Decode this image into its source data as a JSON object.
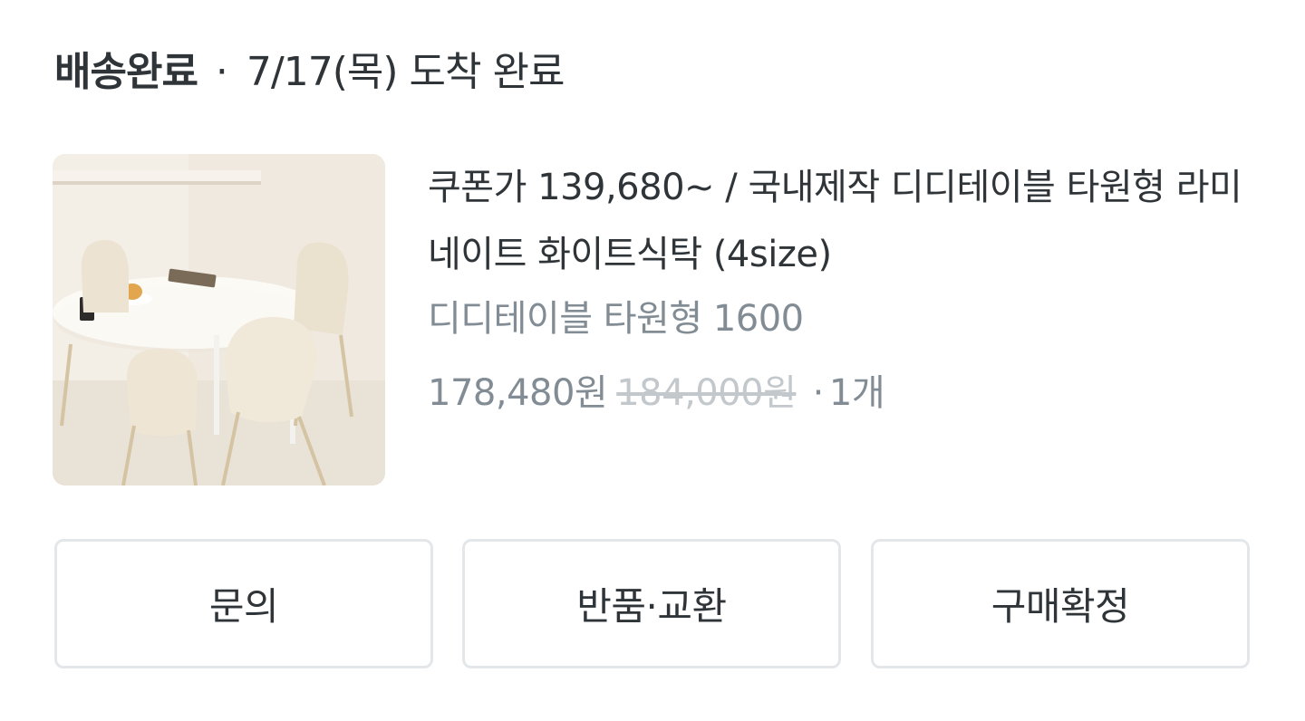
{
  "order": {
    "status": "배송완료",
    "separator": "·",
    "arrival": "7/17(목) 도착 완료"
  },
  "product": {
    "image_alt": "white oval dining table with cream chairs",
    "title": "쿠폰가 139,680~ / 국내제작 디디테이블 타원형 라미네이트 화이트식탁 (4size)",
    "option": "디디테이블 타원형 1600",
    "price_sale": "178,480원",
    "price_original": "184,000원",
    "qty_separator": "·",
    "quantity": "1개"
  },
  "actions": {
    "inquiry": "문의",
    "return_exchange": "반품·교환",
    "confirm_purchase": "구매확정"
  },
  "colors": {
    "text_primary": "#2f3438",
    "text_secondary": "#828c94",
    "text_strike": "#c2c8cc",
    "button_border": "#e4e7ea"
  }
}
